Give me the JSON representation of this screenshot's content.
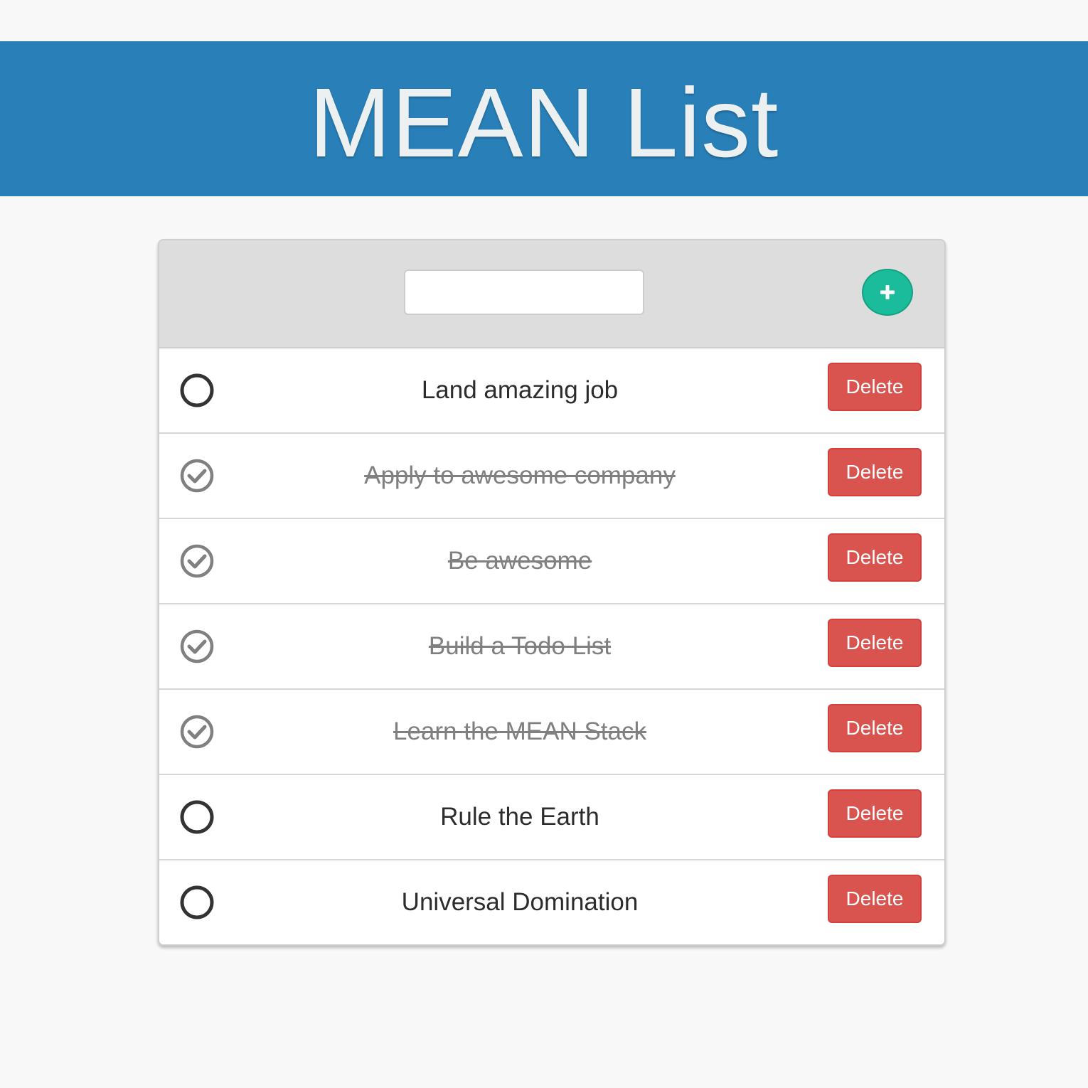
{
  "app": {
    "title": "MEAN List",
    "header_color": "#2980b9"
  },
  "new_todo": {
    "value": "",
    "placeholder": "",
    "add_icon": "plus-icon",
    "add_color": "#1abc9c"
  },
  "delete_color": "#d9534f",
  "todos": [
    {
      "text": "Land amazing job",
      "done": false,
      "icon": "circle-icon",
      "delete_label": "Delete"
    },
    {
      "text": "Apply to awesome company",
      "done": true,
      "icon": "check-circle-icon",
      "delete_label": "Delete"
    },
    {
      "text": "Be awesome",
      "done": true,
      "icon": "check-circle-icon",
      "delete_label": "Delete"
    },
    {
      "text": "Build a Todo List",
      "done": true,
      "icon": "check-circle-icon",
      "delete_label": "Delete"
    },
    {
      "text": "Learn the MEAN Stack",
      "done": true,
      "icon": "check-circle-icon",
      "delete_label": "Delete"
    },
    {
      "text": "Rule the Earth",
      "done": false,
      "icon": "circle-icon",
      "delete_label": "Delete"
    },
    {
      "text": "Universal Domination",
      "done": false,
      "icon": "circle-icon",
      "delete_label": "Delete"
    }
  ]
}
